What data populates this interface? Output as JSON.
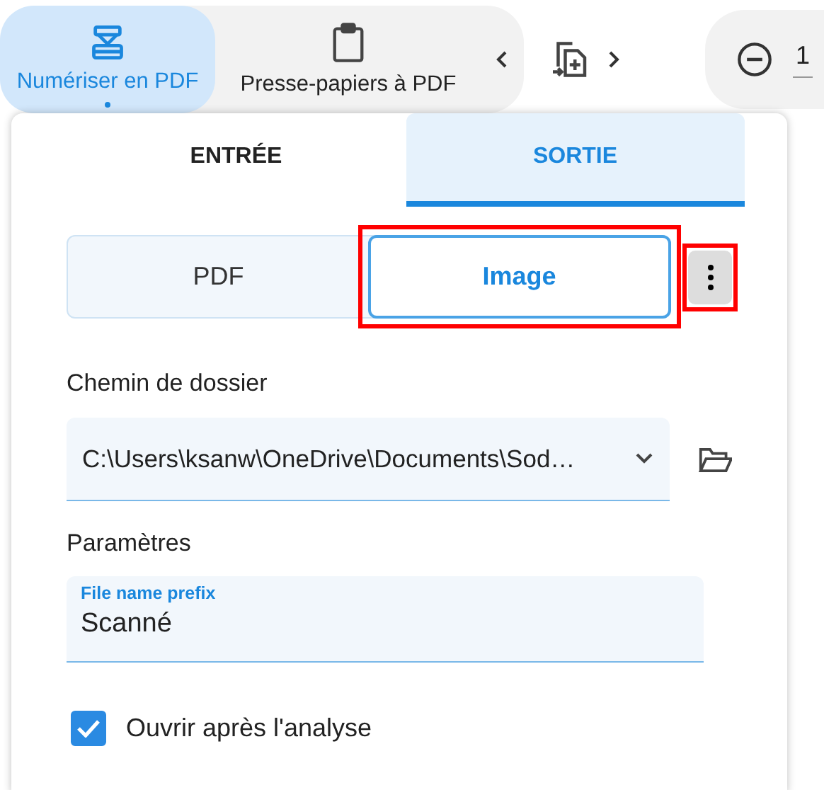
{
  "toolbar": {
    "tabs": [
      {
        "label": "Numériser en PDF",
        "selected": true
      },
      {
        "label": "Presse-papiers à PDF",
        "selected": false
      }
    ],
    "zoom_value": "1"
  },
  "panel": {
    "tabs": [
      {
        "label": "ENTRÉE",
        "selected": false
      },
      {
        "label": "SORTIE",
        "selected": true
      }
    ],
    "formats": [
      {
        "label": "PDF",
        "selected": false,
        "highlighted": false
      },
      {
        "label": "Image",
        "selected": true,
        "highlighted": true
      }
    ],
    "menu_highlighted": true,
    "folder_label": "Chemin de dossier",
    "folder_path": "C:\\Users\\ksanw\\OneDrive\\Documents\\Sod…",
    "settings_label": "Paramètres",
    "prefix_field": {
      "label": "File name prefix",
      "value": "Scanné"
    },
    "open_after": {
      "label": "Ouvrir après l'analyse",
      "checked": true
    }
  }
}
